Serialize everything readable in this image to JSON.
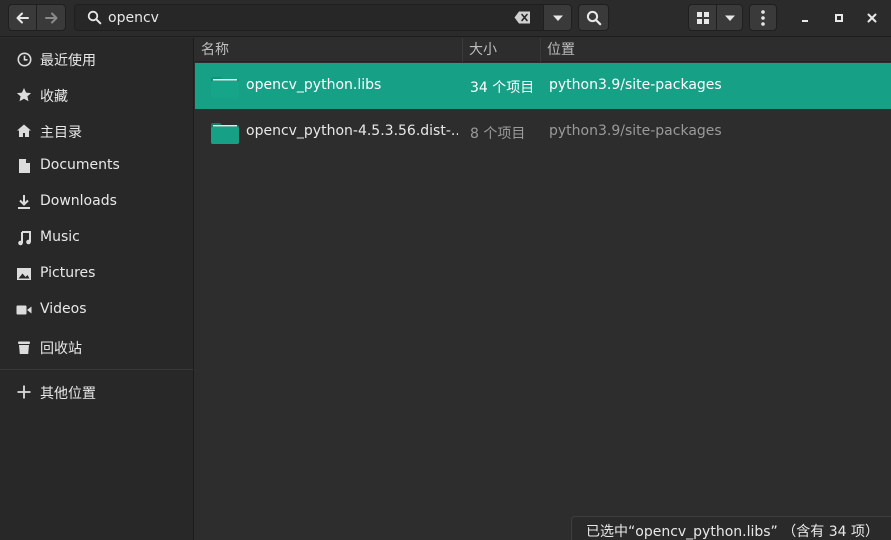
{
  "header": {
    "search": {
      "value": "opencv",
      "placeholder": ""
    },
    "icons": {
      "back": "arrow-left-icon",
      "forward": "arrow-right-icon",
      "search": "search-icon",
      "clear": "backspace-clear-icon",
      "dropdown": "chevron-down-icon",
      "grid": "grid-view-icon",
      "menu": "vertical-ellipsis-icon",
      "minimize": "minimize-icon",
      "maximize": "maximize-icon",
      "close": "close-icon"
    }
  },
  "sidebar": {
    "items": [
      {
        "label": "最近使用",
        "icon": "clock-icon"
      },
      {
        "label": "收藏",
        "icon": "star-icon"
      },
      {
        "label": "主目录",
        "icon": "home-icon"
      },
      {
        "label": "Documents",
        "icon": "document-icon"
      },
      {
        "label": "Downloads",
        "icon": "download-icon"
      },
      {
        "label": "Music",
        "icon": "music-icon"
      },
      {
        "label": "Pictures",
        "icon": "picture-icon"
      },
      {
        "label": "Videos",
        "icon": "video-icon"
      },
      {
        "label": "回收站",
        "icon": "trash-icon"
      }
    ],
    "other_locations": {
      "label": "其他位置",
      "icon": "plus-icon"
    }
  },
  "list": {
    "columns": {
      "name": "名称",
      "size": "大小",
      "location": "位置"
    },
    "rows": [
      {
        "name": "opencv_python.libs",
        "size": "34 个项目",
        "location": "python3.9/site-packages",
        "selected": true
      },
      {
        "name": "opencv_python-4.5.3.56.dist-...",
        "size": "8 个项目",
        "location": "python3.9/site-packages",
        "selected": false
      }
    ]
  },
  "status": {
    "text": "已选中“opencv_python.libs” （含有 34 项）"
  },
  "colors": {
    "accent": "#16a085",
    "background": "#2d2d2d",
    "sidebar": "#282828"
  }
}
